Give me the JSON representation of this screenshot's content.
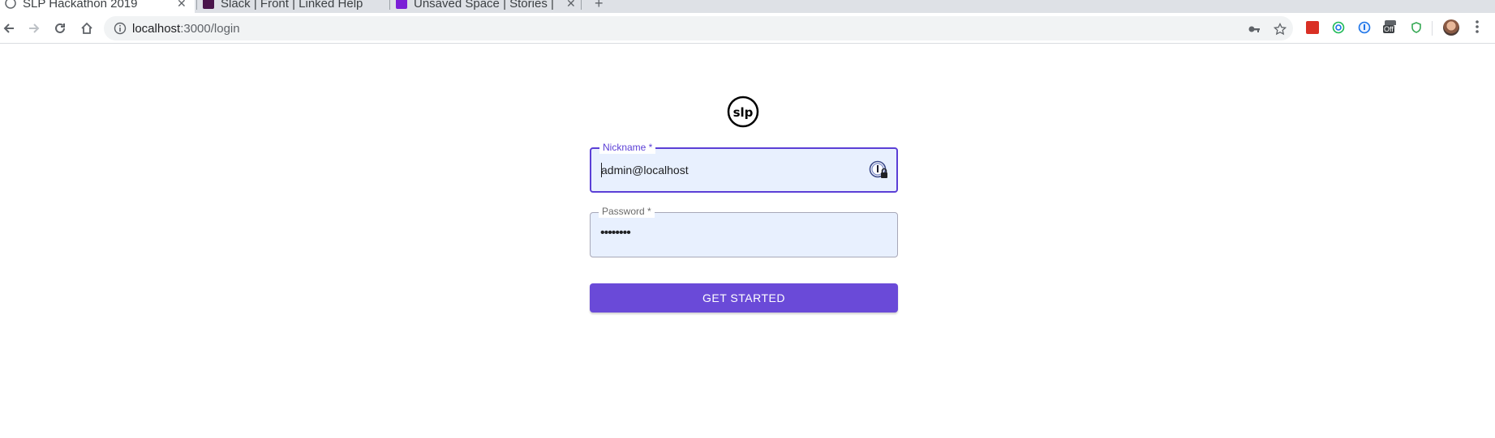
{
  "browser": {
    "tabs": [
      {
        "title": "SLP Hackathon 2019",
        "favicon": "globe-icon"
      },
      {
        "title": "Slack | Front | Linked Help",
        "favicon": "slack-icon"
      },
      {
        "title": "Unsaved Space | Stories | ",
        "favicon": "stories-icon"
      }
    ],
    "url_host": "localhost",
    "url_path": ":3000/login",
    "new_tab_label": "+",
    "extension_badge": "Off"
  },
  "login": {
    "logo_text": "slp",
    "nickname": {
      "label": "Nickname *",
      "value": "admin@localhost"
    },
    "password": {
      "label": "Password *",
      "value": "••••••••"
    },
    "submit_label": "GET STARTED"
  },
  "colors": {
    "accent": "#6a4ad8",
    "focus_border": "#5b3fd6",
    "field_fill": "#e8f0fe"
  }
}
